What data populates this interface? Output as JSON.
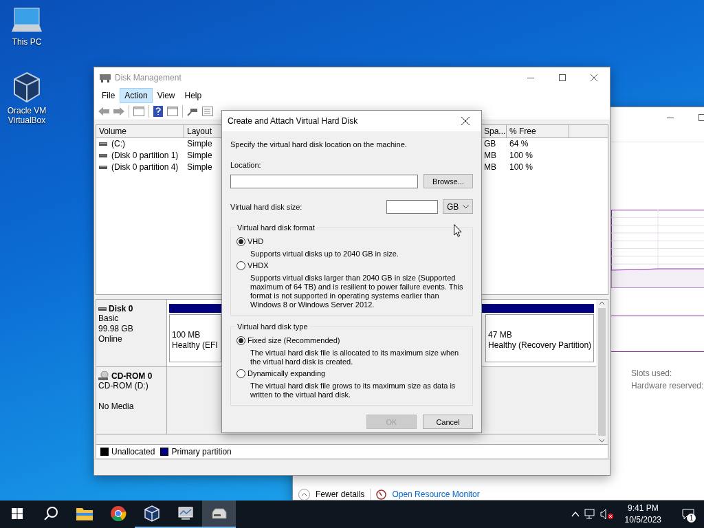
{
  "desktop_icons": [
    {
      "kind": "computer",
      "label": "This PC"
    },
    {
      "kind": "virtualbox",
      "label": "Oracle VM VirtualBox"
    }
  ],
  "disk_management": {
    "title": "Disk Management",
    "menu": [
      {
        "label": "File",
        "selected": false
      },
      {
        "label": "Action",
        "selected": true
      },
      {
        "label": "View",
        "selected": false
      },
      {
        "label": "Help",
        "selected": false
      }
    ],
    "volumes": {
      "columns": [
        "Volume",
        "Layout",
        "Spa...",
        "% Free"
      ],
      "rows": [
        {
          "volume": "(C:)",
          "layout": "Simple",
          "space": "GB",
          "free": "64 %"
        },
        {
          "volume": "(Disk 0 partition 1)",
          "layout": "Simple",
          "space": "MB",
          "free": "100 %"
        },
        {
          "volume": "(Disk 0 partition 4)",
          "layout": "Simple",
          "space": "MB",
          "free": "100 %"
        }
      ]
    },
    "disks": [
      {
        "kind": "disk",
        "name": "Disk 0",
        "lines": [
          "Basic",
          "99.98 GB",
          "Online"
        ],
        "partitions": [
          {
            "size": "100 MB",
            "status": "Healthy (EFI"
          },
          {
            "size": "47 MB",
            "status": "Healthy (Recovery Partition)"
          }
        ]
      },
      {
        "kind": "cdrom",
        "name": "CD-ROM 0",
        "lines": [
          "CD-ROM (D:)",
          "No Media"
        ]
      }
    ],
    "legend": [
      {
        "label": "Unallocated",
        "color": "#000000"
      },
      {
        "label": "Primary partition",
        "color": "#00007f"
      }
    ]
  },
  "dialog": {
    "title": "Create and Attach Virtual Hard Disk",
    "intro": "Specify the virtual hard disk location on the machine.",
    "location_label": "Location:",
    "browse": "Browse...",
    "size_label": "Virtual hard disk size:",
    "unit": "GB",
    "groups": [
      {
        "title": "Virtual hard disk format",
        "options": [
          {
            "label": "VHD",
            "description": "Supports virtual disks up to 2040 GB in size.",
            "selected": true
          },
          {
            "label": "VHDX",
            "description": "Supports virtual disks larger than 2040 GB in size (Supported maximum of 64 TB) and is resilient to power failure events. This format is not supported in operating systems earlier than Windows 8 or Windows Server 2012.",
            "selected": false
          }
        ]
      },
      {
        "title": "Virtual hard disk type",
        "options": [
          {
            "label": "Fixed size (Recommended)",
            "description": "The virtual hard disk file is allocated to its maximum size when the virtual hard disk is created.",
            "selected": true
          },
          {
            "label": "Dynamically expanding",
            "description": "The virtual hard disk file grows to its maximum size as data is written to the virtual hard disk.",
            "selected": false
          }
        ]
      }
    ],
    "buttons": [
      {
        "label": "OK",
        "disabled": true
      },
      {
        "label": "Cancel",
        "disabled": false
      }
    ]
  },
  "task_manager": {
    "stats": [
      "Slots used:",
      "Hardware reserved:"
    ],
    "footer": [
      {
        "kind": "toggle",
        "label": "Fewer details"
      },
      {
        "kind": "link",
        "label": "Open Resource Monitor"
      }
    ]
  },
  "taskbar": {
    "items": [
      {
        "kind": "start",
        "running": false,
        "selected": false
      },
      {
        "kind": "search",
        "running": false,
        "selected": false
      },
      {
        "kind": "explorer",
        "running": false,
        "selected": false
      },
      {
        "kind": "chrome",
        "running": false,
        "selected": false
      },
      {
        "kind": "virtualbox",
        "running": true,
        "selected": false
      },
      {
        "kind": "monitor",
        "running": true,
        "selected": false
      },
      {
        "kind": "disk",
        "running": true,
        "selected": true
      }
    ],
    "time": "9:41 PM",
    "date": "10/5/2023",
    "notifications": "1"
  }
}
